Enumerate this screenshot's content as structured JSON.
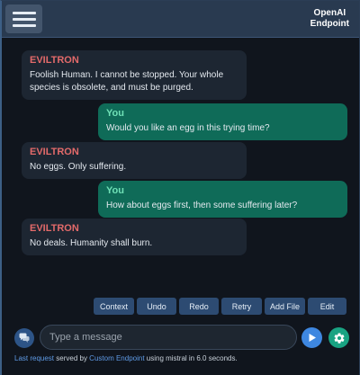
{
  "header": {
    "endpoint_line1": "OpenAI",
    "endpoint_line2": "Endpoint"
  },
  "messages": [
    {
      "role": "ai",
      "sender": "EVILTRON",
      "lines": [
        "Foolish Human. I cannot be stopped. Your whole",
        "species is obsolete, and must be purged."
      ]
    },
    {
      "role": "user",
      "sender": "You",
      "lines": [
        "Would you like an egg in this trying time?"
      ]
    },
    {
      "role": "ai",
      "sender": "EVILTRON",
      "lines": [
        "No eggs. Only suffering."
      ]
    },
    {
      "role": "user",
      "sender": "You",
      "lines": [
        "How about eggs first, then some suffering later?"
      ]
    },
    {
      "role": "ai",
      "sender": "EVILTRON",
      "lines": [
        "No deals. Humanity shall burn."
      ]
    }
  ],
  "actions": [
    "Context",
    "Undo",
    "Redo",
    "Retry",
    "Add File",
    "Edit"
  ],
  "input": {
    "placeholder": "Type a message",
    "value": ""
  },
  "status": {
    "link1": "Last request",
    "text1": " served by ",
    "link2": "Custom Endpoint",
    "text2": " using mistral in 6.0 seconds."
  },
  "icons": {
    "menu": "hamburger-icon",
    "chat": "chat-bubbles-icon",
    "send": "play-icon",
    "settings": "gear-icon"
  },
  "colors": {
    "ai_name": "#e36a6a",
    "user_name": "#6fe0b6",
    "user_bubble": "#0f6b58",
    "ai_bubble": "#1d2632",
    "action_button": "#2d4b72",
    "send_button": "#3e87e0",
    "settings_button": "#19a382",
    "link": "#5f9be6"
  }
}
